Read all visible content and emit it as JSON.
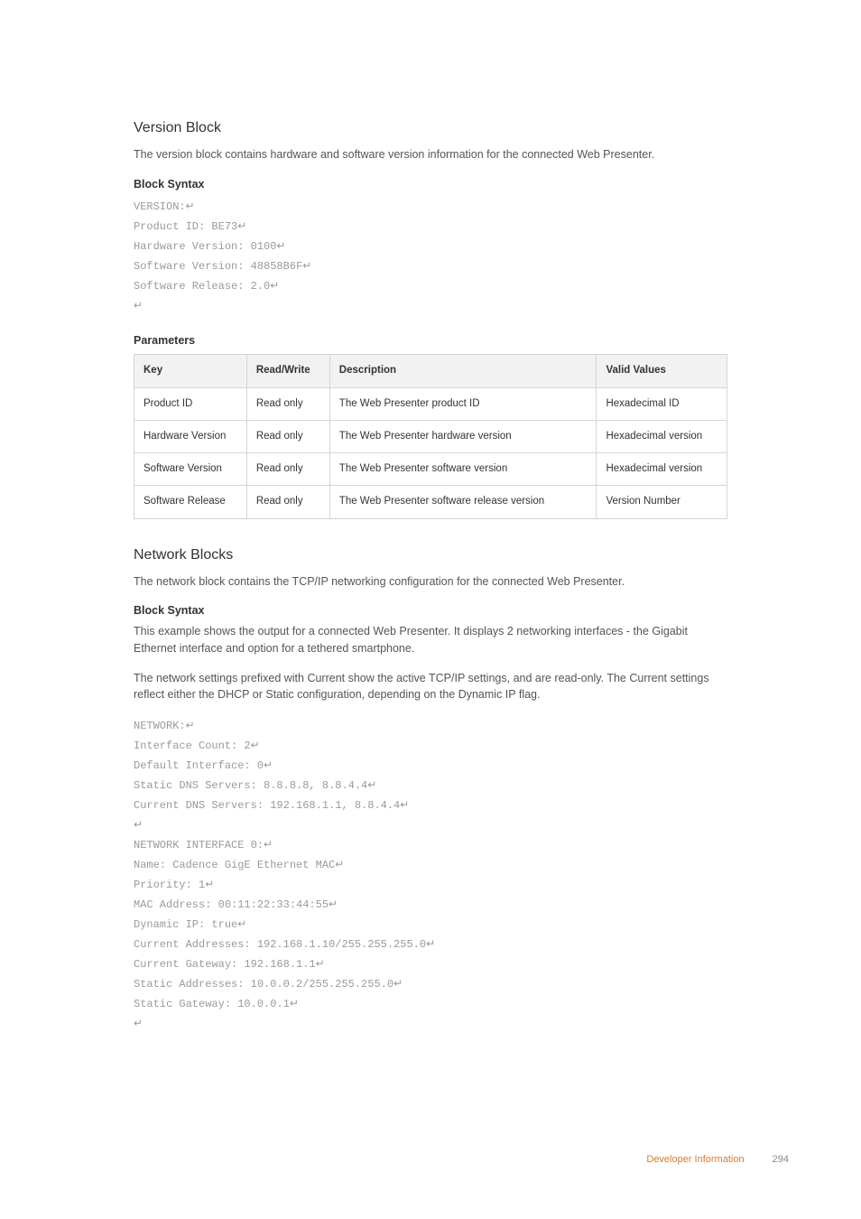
{
  "section1": {
    "title": "Version Block",
    "desc": "The version block contains hardware and software version information for the connected Web Presenter.",
    "blockSyntaxHeading": "Block Syntax",
    "code": [
      "VERSION:",
      "Product ID: BE73",
      "Hardware Version: 0100",
      "Software Version: 48858B6F",
      "Software Release: 2.0",
      ""
    ],
    "paramsHeading": "Parameters",
    "table": {
      "headers": {
        "key": "Key",
        "rw": "Read/Write",
        "desc": "Description",
        "vv": "Valid Values"
      },
      "rows": [
        {
          "key": "Product ID",
          "rw": "Read only",
          "desc": "The Web Presenter product ID",
          "vv": "Hexadecimal ID"
        },
        {
          "key": "Hardware Version",
          "rw": "Read only",
          "desc": "The Web Presenter hardware version",
          "vv": "Hexadecimal version"
        },
        {
          "key": "Software Version",
          "rw": "Read only",
          "desc": "The Web Presenter software version",
          "vv": "Hexadecimal version"
        },
        {
          "key": "Software Release",
          "rw": "Read only",
          "desc": "The Web Presenter software release version",
          "vv": "Version Number"
        }
      ]
    }
  },
  "section2": {
    "title": "Network Blocks",
    "desc": "The network block contains the TCP/IP networking configuration for the connected Web Presenter.",
    "blockSyntaxHeading": "Block Syntax",
    "para1": "This example shows the output for a connected Web Presenter. It displays 2 networking interfaces - the Gigabit Ethernet interface and option for a tethered smartphone.",
    "para2": "The network settings prefixed with Current show the active TCP/IP settings, and are read-only. The Current settings reflect either the DHCP or Static configuration, depending on the Dynamic IP flag.",
    "code": [
      "NETWORK:",
      "Interface Count: 2",
      "Default Interface: 0",
      "Static DNS Servers: 8.8.8.8, 8.8.4.4",
      "Current DNS Servers: 192.168.1.1, 8.8.4.4",
      "",
      "NETWORK INTERFACE 0:",
      "Name: Cadence GigE Ethernet MAC",
      "Priority: 1",
      "MAC Address: 00:11:22:33:44:55",
      "Dynamic IP: true",
      "Current Addresses: 192.168.1.10/255.255.255.0",
      "Current Gateway: 192.168.1.1",
      "Static Addresses: 10.0.0.2/255.255.255.0",
      "Static Gateway: 10.0.0.1",
      ""
    ]
  },
  "footer": {
    "label": "Developer Information",
    "page": "294"
  }
}
